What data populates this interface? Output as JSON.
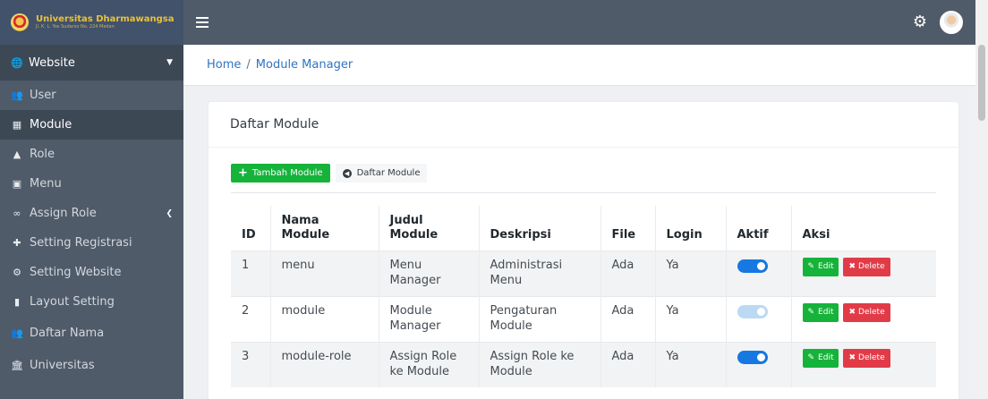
{
  "brand": {
    "title": "Universitas Dharmawangsa",
    "subtitle": "Jl. K. L. Yos Sudarso No. 224 Medan"
  },
  "sidebar": {
    "section": {
      "label": "Website",
      "icon": "globe-icon"
    },
    "items": [
      {
        "label": "User",
        "icon": "users-icon"
      },
      {
        "label": "Module",
        "icon": "sitemap-icon",
        "active": true
      },
      {
        "label": "Role",
        "icon": "user-secret-icon"
      },
      {
        "label": "Menu",
        "icon": "clone-icon"
      },
      {
        "label": "Assign Role",
        "icon": "link-icon"
      },
      {
        "label": "Setting Registrasi",
        "icon": "user-plus-icon"
      },
      {
        "label": "Setting Website",
        "icon": "gear-icon"
      },
      {
        "label": "Layout Setting",
        "icon": "clipboard-icon"
      },
      {
        "label": "Daftar Nama",
        "icon": "users-icon"
      },
      {
        "label": "Universitas",
        "icon": "university-icon"
      }
    ]
  },
  "breadcrumb": {
    "home": "Home",
    "separator": "/",
    "current": "Module Manager"
  },
  "card": {
    "title": "Daftar Module",
    "add_button": "Tambah Module",
    "list_button": "Daftar Module"
  },
  "table": {
    "headers": [
      "ID",
      "Nama Module",
      "Judul Module",
      "Deskripsi",
      "File",
      "Login",
      "Aktif",
      "Aksi"
    ],
    "rows": [
      {
        "id": "1",
        "nama": "menu",
        "judul": "Menu Manager",
        "deskripsi": "Administrasi Menu",
        "file": "Ada",
        "login": "Ya",
        "aktif": true
      },
      {
        "id": "2",
        "nama": "module",
        "judul": "Module Manager",
        "deskripsi": "Pengaturan Module",
        "file": "Ada",
        "login": "Ya",
        "aktif": false
      },
      {
        "id": "3",
        "nama": "module-role",
        "judul": "Assign Role ke Module",
        "deskripsi": "Assign Role ke Module",
        "file": "Ada",
        "login": "Ya",
        "aktif": true
      }
    ],
    "edit_label": "Edit",
    "delete_label": "Delete"
  },
  "colors": {
    "sidebar": "#4f5b69",
    "accent_green": "#16b33a",
    "danger": "#e23b48",
    "toggle_on": "#1678e0",
    "link": "#2f74c0"
  }
}
